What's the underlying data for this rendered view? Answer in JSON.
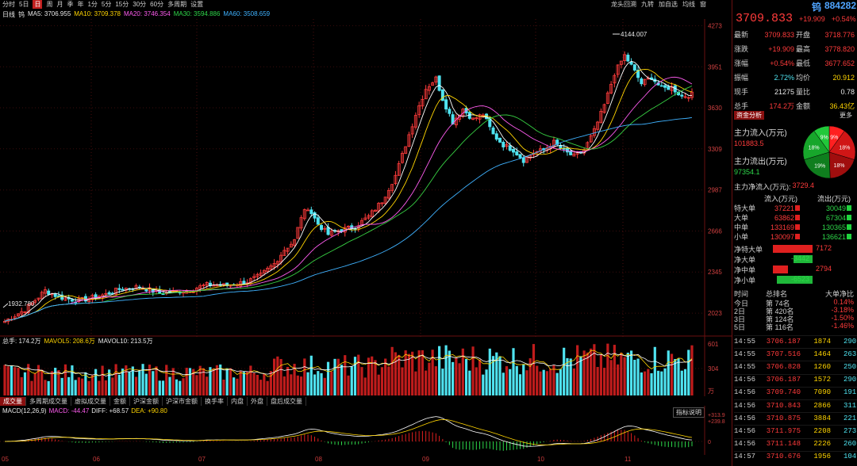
{
  "toolbar": {
    "items": [
      "分时",
      "5日",
      "日",
      "周",
      "月",
      "季",
      "年",
      "1分",
      "5分",
      "15分",
      "30分",
      "60分",
      "多周期",
      "设置"
    ],
    "active_index": 2,
    "right_items": [
      "龙头回溯",
      "九转",
      "加自选",
      "均线",
      "窗"
    ]
  },
  "indicators": {
    "period": "日线",
    "sym": "钨",
    "ma5": "MA5: 3706.955",
    "ma10": "MA10: 3709.378",
    "ma20": "MA20: 3746.354",
    "ma30": "MA30: 3594.886",
    "ma60": "MA60: 3508.659"
  },
  "colors": {
    "up": "#ff3b3b",
    "down": "#4fe3f0",
    "ma5": "#ffffff",
    "ma10": "#ffd400",
    "ma20": "#ff5cf0",
    "ma30": "#37d043",
    "ma60": "#3fb2ff",
    "grid": "#5a1212"
  },
  "price_scale": [
    "4273",
    "3951",
    "3630",
    "3309",
    "2987",
    "2666",
    "2345",
    "2023"
  ],
  "annotations": {
    "high": "4144.007",
    "low": "1932.780"
  },
  "volume": {
    "label": "总手: 174.2万",
    "mavol5": "MAVOL5: 208.6万",
    "mavol10": "MAVOL10: 213.5万",
    "scale": [
      "601",
      "304",
      "万"
    ]
  },
  "tabs": [
    "成交量",
    "多周期成交量",
    "虚拟成交量",
    "金额",
    "沪深金额",
    "沪深市金额",
    "换手率",
    "内盘",
    "外盘",
    "盘后成交量"
  ],
  "macd": {
    "label": "MACD(12,26,9)",
    "macd": "MACD: -44.47",
    "diff": "DIFF: +68.57",
    "dea": "DEA: +90.80",
    "scale": [
      "+313.9",
      "+239.8",
      "0"
    ],
    "button": "指标说明"
  },
  "xaxis": [
    "05",
    "06",
    "07",
    "08",
    "09",
    "10",
    "11"
  ],
  "side": {
    "name": "钨",
    "code": "884282",
    "price": "3709.833",
    "change": "+19.909",
    "pct": "+0.54%",
    "quote": [
      {
        "k": "最新",
        "v": "3709.833",
        "k2": "开盘",
        "v2": "3718.776"
      },
      {
        "k": "涨跌",
        "v": "+19.909",
        "k2": "最高",
        "v2": "3778.820"
      },
      {
        "k": "涨幅",
        "v": "+0.54%",
        "k2": "最低",
        "v2": "3677.652"
      },
      {
        "k": "振幅",
        "v": "2.72%",
        "k2": "均价",
        "v2": "20.912"
      },
      {
        "k": "现手",
        "v": "21275",
        "k2": "量比",
        "v2": "0.78"
      },
      {
        "k": "总手",
        "v": "174.2万",
        "k2": "金额",
        "v2": "36.43亿"
      }
    ],
    "fund_tab": "资金分析",
    "more": "更多",
    "inflow_label": "主力流入(万元)",
    "inflow": "101883.5",
    "outflow_label": "主力流出(万元)",
    "outflow": "97354.1",
    "net_label": "主力净流入(万元):",
    "net": "3729.4",
    "pie": [
      {
        "label": "9%",
        "value": 9,
        "color": "#ff2020"
      },
      {
        "label": "18%",
        "value": 18,
        "color": "#d01616"
      },
      {
        "label": "18%",
        "value": 18,
        "color": "#a00e0e"
      },
      {
        "label": "19%",
        "value": 19,
        "color": "#0f7e1e"
      },
      {
        "label": "18%",
        "value": 18,
        "color": "#17a62b"
      },
      {
        "label": "9%",
        "value": 9,
        "color": "#22c83a"
      }
    ],
    "flow_header": {
      "a": "流入(万元)",
      "b": "流出(万元)"
    },
    "flows": [
      {
        "n": "特大单",
        "a": "37221",
        "b": "30049"
      },
      {
        "n": "大单",
        "a": "63862",
        "b": "67304"
      },
      {
        "n": "中单",
        "a": "133169",
        "b": "130365"
      },
      {
        "n": "小单",
        "a": "130097",
        "b": "136621"
      }
    ],
    "nets": [
      {
        "n": "净特大单",
        "v": "7172",
        "val": 7172
      },
      {
        "n": "净大单",
        "v": "-3442",
        "val": -3442
      },
      {
        "n": "净中单",
        "v": "2794",
        "val": 2794
      },
      {
        "n": "净小单",
        "v": "-6523",
        "val": -6523
      }
    ],
    "rank_header": {
      "d": "时间",
      "r": "总排名",
      "p": "大单净比"
    },
    "ranks": [
      {
        "d": "今日",
        "r": "第   74名",
        "p": "0.14%"
      },
      {
        "d": "2日",
        "r": "第  420名",
        "p": "-3.18%"
      },
      {
        "d": "3日",
        "r": "第  124名",
        "p": "-1.50%"
      },
      {
        "d": "5日",
        "r": "第  116名",
        "p": "-1.46%"
      }
    ],
    "ticks": [
      {
        "t": "14:55",
        "p": "3706.187",
        "v": "1874",
        "s": "",
        "c": "290"
      },
      {
        "t": "14:55",
        "p": "3707.516",
        "v": "1464",
        "s": "",
        "c": "263"
      },
      {
        "t": "14:55",
        "p": "3706.828",
        "v": "1260",
        "s": "",
        "c": "250"
      },
      {
        "t": "14:56",
        "p": "3706.187",
        "v": "1572",
        "s": "",
        "c": "290"
      },
      {
        "t": "14:56",
        "p": "3709.740",
        "v": "7090",
        "s": "",
        "c": "191"
      },
      {
        "t": "14:56",
        "p": "3710.843",
        "s": "",
        "v": "2866",
        "c": "311"
      },
      {
        "t": "14:56",
        "p": "3710.875",
        "v": "3884",
        "s": "",
        "c": "221"
      },
      {
        "t": "14:56",
        "p": "3711.975",
        "v": "2208",
        "s": "",
        "c": "273"
      },
      {
        "t": "14:56",
        "p": "3711.148",
        "v": "2226",
        "s": "",
        "c": "260"
      },
      {
        "t": "14:57",
        "p": "3710.676",
        "v": "1956",
        "s": "",
        "c": "104"
      }
    ]
  }
}
